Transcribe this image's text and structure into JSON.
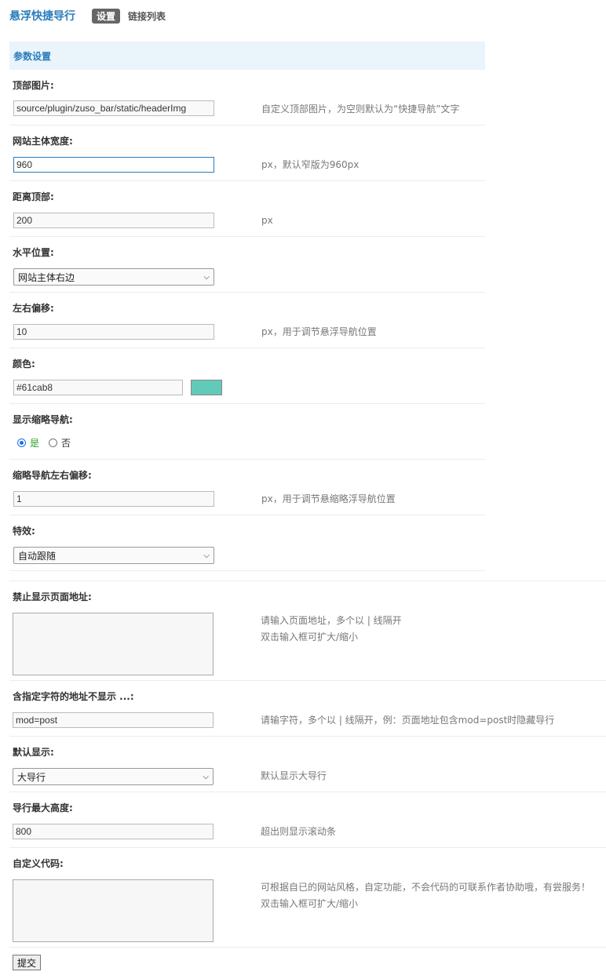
{
  "header": {
    "title": "悬浮快捷导行",
    "tabs": [
      {
        "label": "设置",
        "active": true
      },
      {
        "label": "链接列表",
        "active": false
      }
    ]
  },
  "section": {
    "title": "参数设置"
  },
  "fields": {
    "header_img": {
      "label": "顶部图片:",
      "value": "source/plugin/zuso_bar/static/headerImg",
      "hint": "自定义顶部图片，为空则默认为“快捷导航”文字"
    },
    "main_width": {
      "label": "网站主体宽度:",
      "value": "960",
      "hint": "px，默认窄版为960px"
    },
    "top_distance": {
      "label": "距离顶部:",
      "value": "200",
      "hint": "px"
    },
    "h_position": {
      "label": "水平位置:",
      "selected": "网站主体右边"
    },
    "lr_offset": {
      "label": "左右偏移:",
      "value": "10",
      "hint": "px，用于调节悬浮导航位置"
    },
    "color": {
      "label": "颜色:",
      "value": "#61cab8",
      "swatch": "#61cab8"
    },
    "show_thumb": {
      "label": "显示缩略导航:",
      "yes": "是",
      "no": "否",
      "selected": "yes"
    },
    "thumb_offset": {
      "label": "缩略导航左右偏移:",
      "value": "1",
      "hint": "px，用于调节悬缩略浮导航位置"
    },
    "effect": {
      "label": "特效:",
      "selected": "自动跟随"
    },
    "forbid_urls": {
      "label": "禁止显示页面地址:",
      "hint1": "请输入页面地址，多个以 | 线隔开",
      "hint2": "双击输入框可扩大/缩小"
    },
    "exclude_chars": {
      "label": "含指定字符的地址不显示 ...:",
      "value": "mod=post",
      "hint": "请输字符，多个以 | 线隔开，例：页面地址包含mod=post时隐藏导行"
    },
    "default_show": {
      "label": "默认显示:",
      "selected": "大导行",
      "hint": "默认显示大导行"
    },
    "max_height": {
      "label": "导行最大高度:",
      "value": "800",
      "hint": "超出则显示滚动条"
    },
    "custom_code": {
      "label": "自定义代码:",
      "hint1": "可根据自已的网站风格，自定功能，不会代码的可联系作者协助哦，有尝服务！",
      "hint2": "双击输入框可扩大/缩小"
    }
  },
  "submit": {
    "label": "提交"
  }
}
